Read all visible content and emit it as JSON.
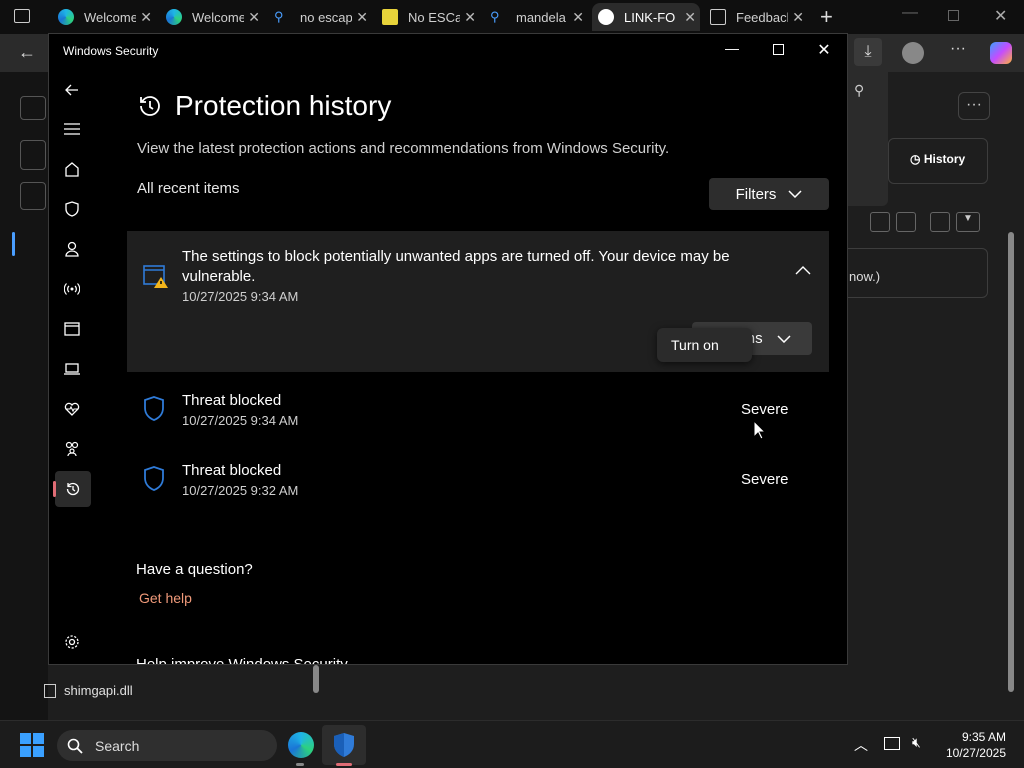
{
  "browser": {
    "tabs": [
      {
        "title": "Welcome",
        "icon": "edge-icon"
      },
      {
        "title": "Welcome",
        "icon": "edge-icon"
      },
      {
        "title": "no escap",
        "icon": "search-icon"
      },
      {
        "title": "No ESCa",
        "icon": "bookmark-icon"
      },
      {
        "title": "mandela",
        "icon": "search-icon"
      },
      {
        "title": "LINK-FO",
        "icon": "github-icon"
      },
      {
        "title": "Feedback",
        "icon": "document-icon"
      }
    ],
    "page": {
      "history_label": "History",
      "partial_text": "now.)"
    }
  },
  "security": {
    "window_title": "Windows Security",
    "page_title": "Protection history",
    "subtitle": "View the latest protection actions and recommendations from Windows Security.",
    "section_label": "All recent items",
    "filters_label": "Filters",
    "card": {
      "message": "The settings to block potentially unwanted apps are turned off. Your device may be vulnerable.",
      "date": "10/27/2025 9:34 AM",
      "actions_label": "Actions",
      "menu_item": "Turn on"
    },
    "threats": [
      {
        "name": "Threat blocked",
        "date": "10/27/2025 9:34 AM",
        "severity": "Severe"
      },
      {
        "name": "Threat blocked",
        "date": "10/27/2025 9:32 AM",
        "severity": "Severe"
      }
    ],
    "question": "Have a question?",
    "help_link": "Get help",
    "improve": "Help improve Windows Security"
  },
  "explorer": {
    "file": "shimgapi.dll"
  },
  "taskbar": {
    "search_placeholder": "Search",
    "time": "9:35 AM",
    "date": "10/27/2025"
  },
  "colors": {
    "accent_link": "#f09a7a",
    "shield": "#2f7bd8",
    "warning": "#f2b41b"
  }
}
